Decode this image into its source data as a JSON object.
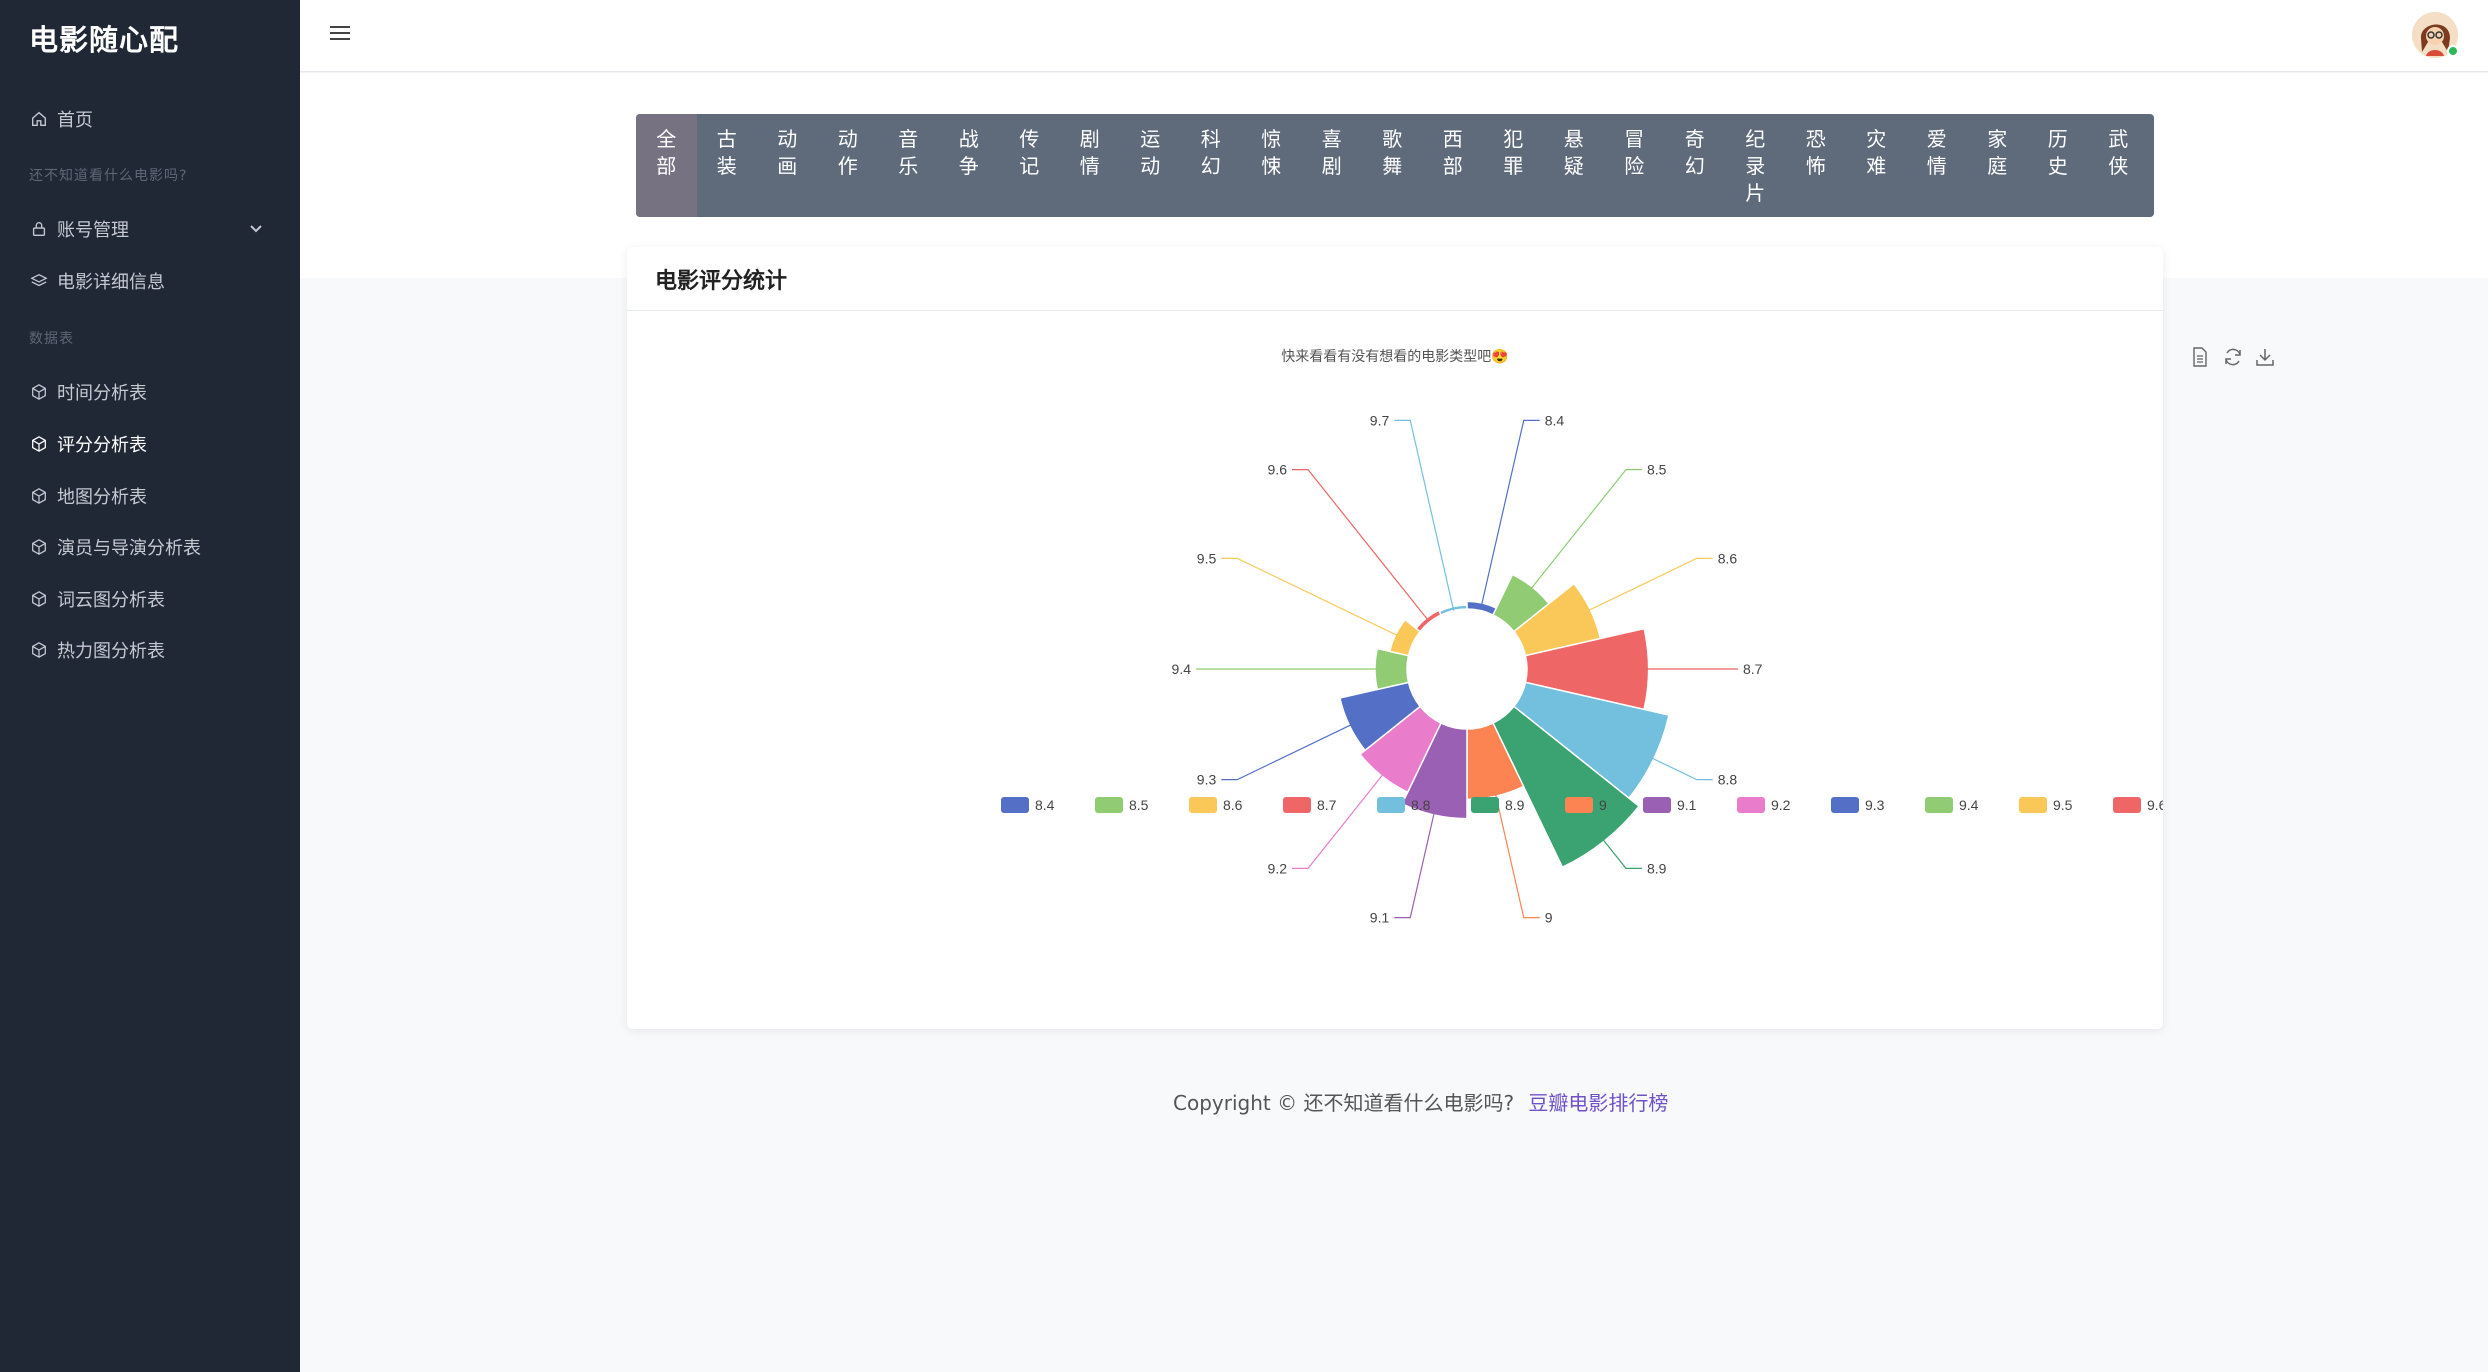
{
  "app": {
    "title": "电影随心配"
  },
  "sidebar": {
    "home": "首页",
    "section1": "还不知道看什么电影吗?",
    "account": "账号管理",
    "detail": "电影详细信息",
    "section2": "数据表",
    "items": [
      {
        "label": "时间分析表",
        "active": false
      },
      {
        "label": "评分分析表",
        "active": true
      },
      {
        "label": "地图分析表",
        "active": false
      },
      {
        "label": "演员与导演分析表",
        "active": false
      },
      {
        "label": "词云图分析表",
        "active": false
      },
      {
        "label": "热力图分析表",
        "active": false
      }
    ]
  },
  "categories": [
    "全部",
    "古装",
    "动画",
    "动作",
    "音乐",
    "战争",
    "传记",
    "剧情",
    "运动",
    "科幻",
    "惊悚",
    "喜剧",
    "歌舞",
    "西部",
    "犯罪",
    "悬疑",
    "冒险",
    "奇幻",
    "纪录片",
    "恐怖",
    "灾难",
    "爱情",
    "家庭",
    "历史",
    "武侠"
  ],
  "active_category": "全部",
  "card": {
    "title": "电影评分统计"
  },
  "footer": {
    "copyright": "Copyright © 还不知道看什么电影吗?",
    "link": "豆瓣电影排行榜"
  },
  "toolbox": [
    "data-view-icon",
    "restore-icon",
    "save-image-icon"
  ],
  "chart_data": {
    "type": "rose-pie",
    "title": "快来看看有没有想看的电影类型吧😍",
    "legend_position": "bottom",
    "categories": [
      "8.4",
      "8.5",
      "8.6",
      "8.7",
      "8.8",
      "8.9",
      "9",
      "9.1",
      "9.2",
      "9.3",
      "9.4",
      "9.5",
      "9.6",
      "9.7"
    ],
    "values": [
      6,
      35,
      60,
      95,
      115,
      125,
      55,
      70,
      60,
      55,
      25,
      15,
      4,
      3
    ],
    "colors": [
      "#5470c6",
      "#91cc75",
      "#fac858",
      "#ee6666",
      "#73c0de",
      "#3ba272",
      "#fc8452",
      "#9a60b4",
      "#ea7ccc",
      "#5470c6",
      "#91cc75",
      "#fac858",
      "#ee6666",
      "#73c0de"
    ]
  }
}
